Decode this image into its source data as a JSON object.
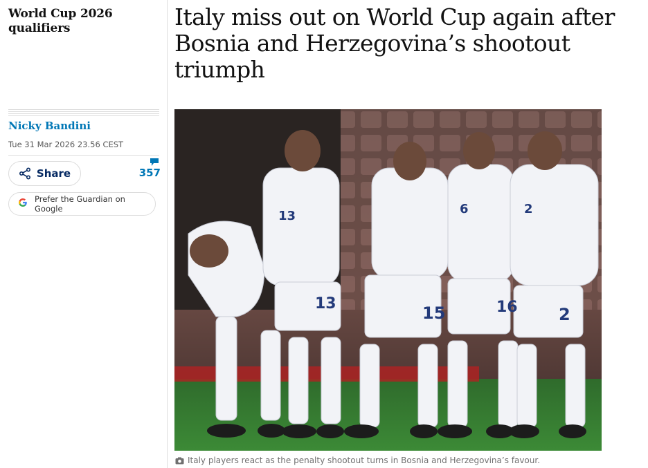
{
  "section": {
    "kicker": "World Cup 2026 qualifiers"
  },
  "article": {
    "headline": "Italy miss out on World Cup again after Bosnia and Herzegovina’s shootout triumph",
    "byline": "Nicky Bandini",
    "date": "Tue 31 Mar 2026 23.56 CEST"
  },
  "actions": {
    "share_label": "Share",
    "comment_count": "357",
    "google_label": "Prefer the Guardian on Google"
  },
  "media": {
    "caption": "Italy players react as the penalty shootout turns in Bosnia and Herzegovina’s favour.",
    "shirt_numbers": [
      "13",
      "15",
      "16",
      "2"
    ]
  },
  "colors": {
    "byline": "#0077b6",
    "share_text": "#052962",
    "pitch": "#2f6b2c",
    "kit": "#f2f3f7",
    "kit_trim": "#233a7a"
  },
  "icons": [
    "share-icon",
    "comment-icon",
    "google-icon",
    "camera-icon"
  ]
}
